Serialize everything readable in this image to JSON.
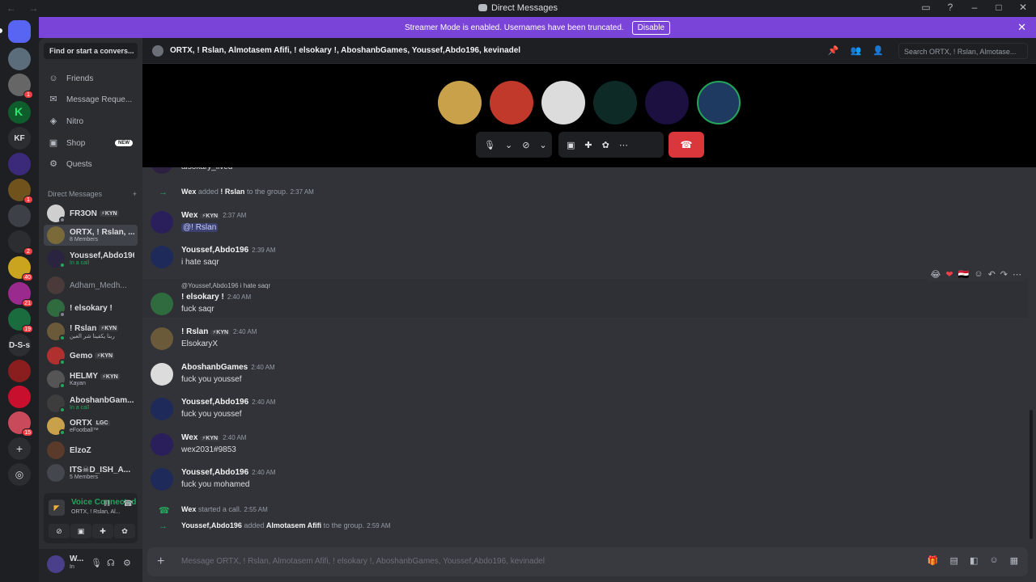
{
  "window": {
    "title": "Direct Messages",
    "back": "←",
    "forward": "→"
  },
  "banner": {
    "text": "Streamer Mode is enabled. Usernames have been truncated.",
    "button": "Disable"
  },
  "sidebar": {
    "search_label": "Find or start a convers...",
    "nav": [
      {
        "label": "Friends",
        "icon": "friends-icon"
      },
      {
        "label": "Message Reque...",
        "icon": "mail-icon"
      },
      {
        "label": "Nitro",
        "icon": "nitro-icon"
      },
      {
        "label": "Shop",
        "icon": "shop-icon",
        "badge": "NEW"
      },
      {
        "label": "Quests",
        "icon": "quests-icon"
      }
    ],
    "dm_header": "Direct Messages",
    "dms": [
      {
        "name": "FR3ON",
        "tag": "⚡KYN",
        "sub": ""
      },
      {
        "name": "ORTX, ! Rslan, ...",
        "tag": "",
        "sub": "8 Members"
      },
      {
        "name": "Youssef,Abdo196",
        "tag": "",
        "sub": "In a call"
      },
      {
        "name": "Adham_Medh...",
        "tag": "",
        "sub": ""
      },
      {
        "name": "! elsokary !",
        "tag": "",
        "sub": ""
      },
      {
        "name": "! Rslan",
        "tag": "⚡KYN",
        "sub": "ربنا يكفينا شر العين"
      },
      {
        "name": "Gemo",
        "tag": "⚡KYN",
        "sub": ""
      },
      {
        "name": "HELMY",
        "tag": "⚡KYN",
        "sub": "Kayan"
      },
      {
        "name": "AboshanbGam...",
        "tag": "",
        "sub": "In a call"
      },
      {
        "name": "ORTX",
        "tag": "LGC",
        "sub": "eFootball™"
      },
      {
        "name": "ElzoZ",
        "tag": "",
        "sub": ""
      },
      {
        "name": "ITS☠D_ISH_A...",
        "tag": "",
        "sub": "5 Members"
      }
    ],
    "voice": {
      "status": "Voice Connected",
      "channel": "ORTX, ! Rslan, Al..."
    },
    "user": {
      "name": "W...",
      "status": "In"
    }
  },
  "guilds": {
    "badges": [
      "1",
      "1",
      "2",
      "40",
      "21",
      "19",
      "15"
    ],
    "text_servers": [
      "KF",
      "D-S-s"
    ]
  },
  "header": {
    "title": "ORTX, ! Rslan, Almotasem Afifi, ! elsokary !, AboshanbGames, Youssef,Abdo196, kevinadel",
    "search_placeholder": "Search ORTX, ! Rslan, Almotase..."
  },
  "call": {
    "avatar_colors": [
      "#c9a14a",
      "#c0392b",
      "#dcdcdc",
      "#0d2a26",
      "#1b1040",
      "#1e3a60"
    ]
  },
  "messages": [
    {
      "type": "partial",
      "body": "alsokary_lived"
    },
    {
      "type": "system",
      "actor": "Wex",
      "action": "added",
      "target": "! Rslan",
      "suffix": "to the group.",
      "time": "2:37 AM"
    },
    {
      "type": "message",
      "author": "Wex",
      "tag": "⚡KYN",
      "time": "2:37 AM",
      "body": "@! Rslan"
    },
    {
      "type": "message",
      "author": "Youssef,Abdo196",
      "tag": "",
      "time": "2:39 AM",
      "body": "i hate saqr"
    },
    {
      "type": "reply",
      "reply_to": "@Youssef,Abdo196 i hate saqr",
      "author": "! elsokary !",
      "tag": "",
      "time": "2:40 AM",
      "body": "fuck saqr"
    },
    {
      "type": "message",
      "author": "! Rslan",
      "tag": "⚡KYN",
      "time": "2:40 AM",
      "body": "ElsokaryX"
    },
    {
      "type": "message",
      "author": "AboshanbGames",
      "tag": "",
      "time": "2:40 AM",
      "body": "fuck you youssef"
    },
    {
      "type": "message",
      "author": "Youssef,Abdo196",
      "tag": "",
      "time": "2:40 AM",
      "body": "fuck you youssef"
    },
    {
      "type": "message",
      "author": "Wex",
      "tag": "⚡KYN",
      "time": "2:40 AM",
      "body": "wex2031#9853"
    },
    {
      "type": "message",
      "author": "Youssef,Abdo196",
      "tag": "",
      "time": "2:40 AM",
      "body": "fuck you mohamed"
    },
    {
      "type": "system",
      "actor": "Wex",
      "action": "started a call.",
      "target": "",
      "suffix": "",
      "time": "2:55 AM"
    },
    {
      "type": "system",
      "actor": "Youssef,Abdo196",
      "action": "added",
      "target": "Almotasem Afifi",
      "suffix": "to the group.",
      "time": "2:59 AM"
    }
  ],
  "reactions": [
    "😂",
    "❤",
    "🇪🇬"
  ],
  "composer": {
    "placeholder": "Message ORTX, ! Rslan, Almotasem Afifi, ! elsokary !, AboshanbGames, Youssef,Abdo196, kevinadel"
  },
  "colors": {
    "accent": "#5865f2",
    "banner": "#7b44d8",
    "hangup": "#da373c",
    "online": "#23a55a"
  }
}
